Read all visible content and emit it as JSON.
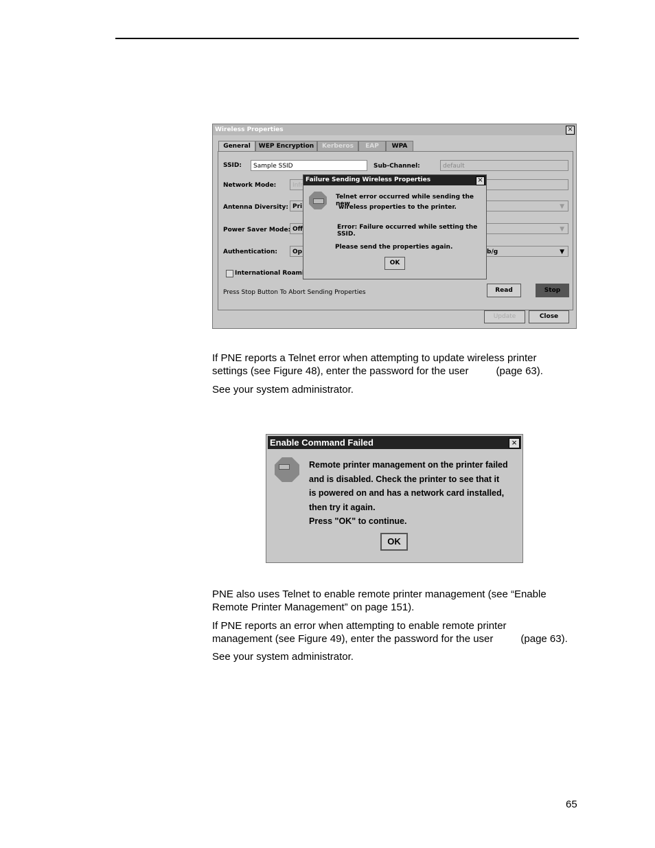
{
  "figure48": {
    "window_title": "Wireless Properties",
    "tabs": [
      "General",
      "WEP Encryption",
      "Kerberos",
      "EAP",
      "WPA"
    ],
    "ssid_label": "SSID:",
    "ssid_value": "Sample SSID",
    "subchannel_label": "Sub-Channel:",
    "subchannel_value": "default",
    "network_mode_label": "Network Mode:",
    "network_mode_value": "Infr",
    "antenna_label": "Antenna Diversity:",
    "antenna_value": "Pri",
    "power_label": "Power Saver Mode:",
    "power_value": "Off",
    "auth_label": "Authentication:",
    "auth_value": "Op",
    "right_select_value": "b/g",
    "roaming_label": "International Roaming",
    "status_text": "Press Stop Button To Abort Sending Properties",
    "read_btn": "Read",
    "stop_btn": "Stop",
    "update_btn": "Update",
    "close_btn": "Close",
    "dialog": {
      "title": "Failure Sending Wireless Properties",
      "line1": "Telnet error occurred while sending the new",
      "line2": "wireless properties to the printer.",
      "line3": "Error: Failure occurred while setting the SSID.",
      "line4": "Please send the properties again.",
      "ok": "OK"
    }
  },
  "para1": {
    "line1": "If PNE reports a Telnet error when attempting to update wireless printer",
    "line2a": "settings (see Figure 48), enter the password for the user",
    "line2b": "(page 63)."
  },
  "para2": "See your system administrator.",
  "figure49": {
    "title": "Enable Command Failed",
    "lines": [
      "Remote printer management on the printer failed",
      "and is disabled. Check the printer to see that it",
      "is powered on and has a network card installed,",
      "then try it again.",
      "Press \"OK\" to continue."
    ],
    "ok": "OK"
  },
  "para3": {
    "line1": "PNE also uses Telnet to enable remote printer management (see “Enable",
    "line2": "Remote Printer Management” on page 151)."
  },
  "para4": {
    "line1": "If PNE reports an error when attempting to enable remote printer",
    "line2a": "management (see Figure 49), enter the password for the user",
    "line2b": "(page 63)."
  },
  "para5": "See your system administrator.",
  "page_number": "65"
}
